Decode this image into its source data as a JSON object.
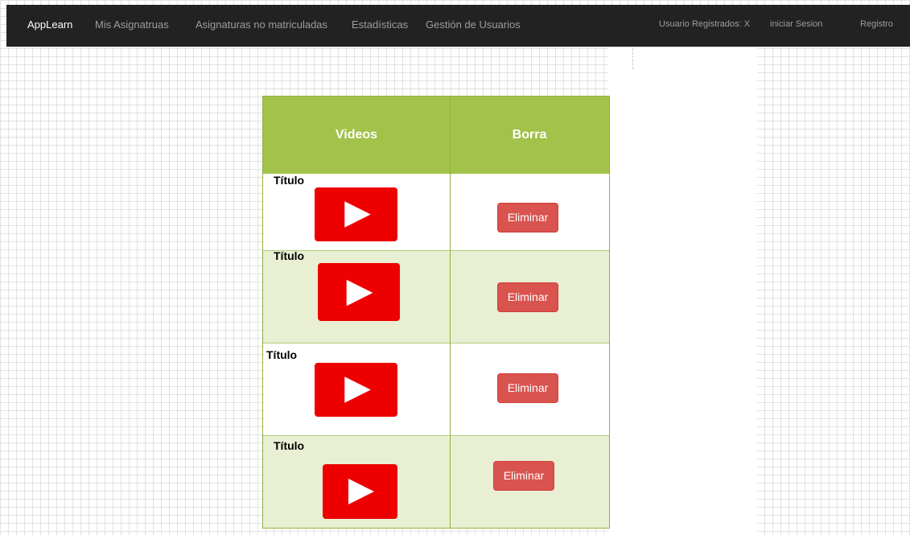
{
  "navbar": {
    "brand": "AppLearn",
    "links": [
      "Mis Asignatruas",
      "Asignaturas no matriculadas",
      "Estadísticas",
      "Gestión de Usuarios"
    ],
    "user_status": "Usuario Registrados: X",
    "login": "iniciar Sesion",
    "register": "Registro"
  },
  "table": {
    "headers": {
      "videos": "Videos",
      "delete": "Borra"
    },
    "rows": [
      {
        "title": "Título",
        "icon": "youtube-play-icon",
        "action": "Eliminar"
      },
      {
        "title": "Título",
        "icon": "youtube-play-icon",
        "action": "Eliminar"
      },
      {
        "title": "Título",
        "icon": "youtube-play-icon",
        "action": "Eliminar"
      },
      {
        "title": "Título",
        "icon": "youtube-play-icon",
        "action": "Eliminar"
      }
    ]
  },
  "colors": {
    "navbar_bg": "#222222",
    "header_green": "#a2c24a",
    "alt_row": "#e8efd3",
    "youtube_red": "#ee0000",
    "danger_button": "#d9534f"
  }
}
